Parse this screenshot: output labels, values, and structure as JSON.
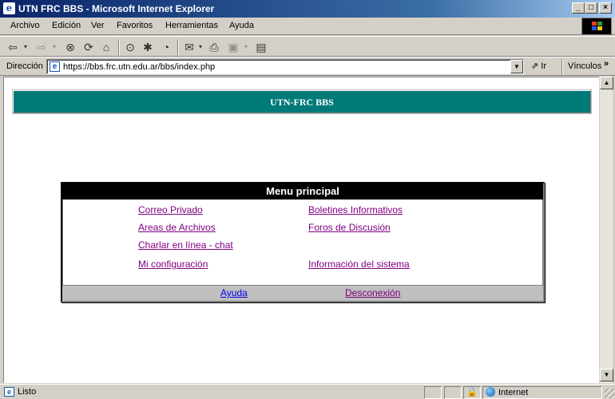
{
  "window": {
    "title": "UTN FRC BBS - Microsoft Internet Explorer",
    "min_label": "_",
    "max_label": "□",
    "close_label": "×"
  },
  "menubar": {
    "items": [
      "Archivo",
      "Edición",
      "Ver",
      "Favoritos",
      "Herramientas",
      "Ayuda"
    ]
  },
  "address": {
    "label": "Dirección",
    "url": "https://bbs.frc.utn.edu.ar/bbs/index.php",
    "go_label": "Ir",
    "links_label": "Vínculos",
    "more_label": "»"
  },
  "page": {
    "banner_title": "UTN-FRC BBS",
    "menu_title": "Menu principal",
    "links": {
      "correo": "Correo Privado",
      "boletines": "Boletines Informativos",
      "areas": "Areas de Archivos",
      "foros": "Foros de Discusión",
      "chat": "Charlar en línea - chat",
      "config": "Mi configuración",
      "info": "Información del sistema"
    },
    "footer": {
      "ayuda": "Ayuda",
      "desconexion": "Desconexión"
    },
    "colors": {
      "banner": "#007a78",
      "visited_link": "#800080",
      "link": "#0000ee"
    }
  },
  "status": {
    "text": "Listo",
    "zone": "Internet"
  },
  "icons": [
    "ie-logo-icon",
    "back-arrow-icon",
    "forward-arrow-icon",
    "stop-icon",
    "refresh-icon",
    "home-icon",
    "search-icon",
    "favorites-icon",
    "history-icon",
    "mail-icon",
    "print-icon",
    "edit-icon",
    "discuss-icon",
    "windows-flag-icon",
    "go-arrow-icon",
    "lock-icon",
    "globe-icon"
  ]
}
